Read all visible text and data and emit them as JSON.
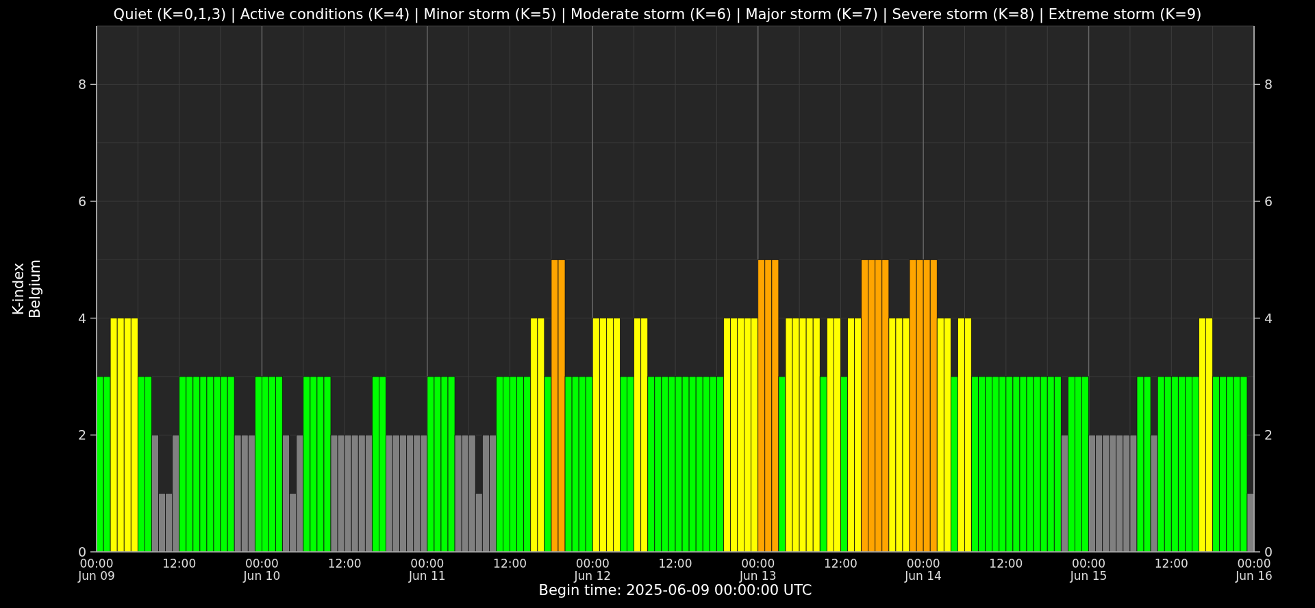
{
  "chart_data": {
    "type": "bar",
    "title": "Quiet (K=0,1,3) | Active conditions (K=4) | Minor storm (K=5) | Moderate storm (K=6) | Major storm (K=7) | Severe storm (K=8) | Extreme storm (K=9)",
    "xlabel": "Begin time: 2025-06-09 00:00:00 UTC",
    "ylabel": "K-index\nBelgium",
    "ylim": [
      0,
      9
    ],
    "yticks": [
      0,
      2,
      4,
      6,
      8
    ],
    "y2ticks": [
      0,
      2,
      4,
      6,
      8
    ],
    "y2lim": [
      0,
      9
    ],
    "grid": true,
    "categories": [
      "00:00\nJun 09",
      null,
      null,
      null,
      null,
      null,
      null,
      null,
      null,
      null,
      null,
      null,
      "12:00",
      null,
      null,
      null,
      null,
      null,
      null,
      null,
      null,
      null,
      null,
      null,
      "00:00\nJun 10",
      null,
      null,
      null,
      null,
      null,
      null,
      null,
      null,
      null,
      null,
      null,
      "12:00",
      null,
      null,
      null,
      null,
      null,
      null,
      null,
      null,
      null,
      null,
      null,
      "00:00\nJun 11",
      null,
      null,
      null,
      null,
      null,
      null,
      null,
      null,
      null,
      null,
      null,
      "12:00",
      null,
      null,
      null,
      null,
      null,
      null,
      null,
      null,
      null,
      null,
      null,
      "00:00\nJun 12",
      null,
      null,
      null,
      null,
      null,
      null,
      null,
      null,
      null,
      null,
      null,
      "12:00",
      null,
      null,
      null,
      null,
      null,
      null,
      null,
      null,
      null,
      null,
      null,
      "00:00\nJun 13",
      null,
      null,
      null,
      null,
      null,
      null,
      null,
      null,
      null,
      null,
      null,
      "12:00",
      null,
      null,
      null,
      null,
      null,
      null,
      null,
      null,
      null,
      null,
      null,
      "00:00\nJun 14",
      null,
      null,
      null,
      null,
      null,
      null,
      null,
      null,
      null,
      null,
      null,
      "12:00",
      null,
      null,
      null,
      null,
      null,
      null,
      null,
      null,
      null,
      null,
      null,
      "00:00\nJun 15",
      null,
      null,
      null,
      null,
      null,
      null,
      null,
      null,
      null,
      null,
      null,
      "12:00",
      null,
      null,
      null,
      null,
      null,
      null,
      null,
      null,
      null,
      null,
      null,
      "00:00\nJun 16"
    ],
    "values": [
      3,
      3,
      4,
      4,
      4,
      4,
      3,
      3,
      2,
      1,
      1,
      2,
      3,
      3,
      3,
      3,
      3,
      3,
      3,
      3,
      2,
      2,
      2,
      3,
      3,
      3,
      3,
      2,
      1,
      2,
      3,
      3,
      3,
      3,
      2,
      2,
      2,
      2,
      2,
      2,
      3,
      3,
      2,
      2,
      2,
      2,
      2,
      2,
      3,
      3,
      3,
      3,
      2,
      2,
      2,
      1,
      2,
      2,
      3,
      3,
      3,
      3,
      3,
      4,
      4,
      3,
      5,
      5,
      3,
      3,
      3,
      3,
      4,
      4,
      4,
      4,
      3,
      3,
      4,
      4,
      3,
      3,
      3,
      3,
      3,
      3,
      3,
      3,
      3,
      3,
      3,
      4,
      4,
      4,
      4,
      4,
      5,
      5,
      5,
      3,
      4,
      4,
      4,
      4,
      4,
      3,
      4,
      4,
      3,
      4,
      4,
      5,
      5,
      5,
      5,
      4,
      4,
      4,
      5,
      5,
      5,
      5,
      4,
      4,
      3,
      4,
      4,
      3,
      3,
      3,
      3,
      3,
      3,
      3,
      3,
      3,
      3,
      3,
      3,
      3,
      2,
      3,
      3,
      3,
      2,
      2,
      2,
      2,
      2,
      2,
      2,
      3,
      3,
      2,
      3,
      3,
      3,
      3,
      3,
      3,
      4,
      4,
      3,
      3,
      3,
      3,
      3,
      1,
      null
    ]
  }
}
